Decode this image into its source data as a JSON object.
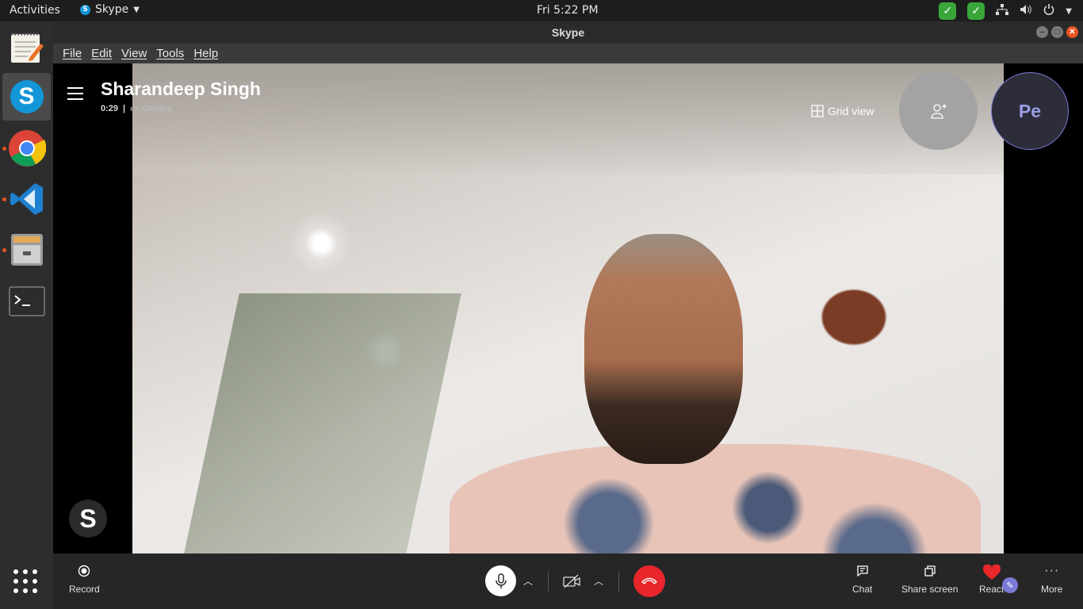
{
  "topbar": {
    "activities": "Activities",
    "app_name": "Skype",
    "clock": "Fri  5:22 PM"
  },
  "window": {
    "title": "Skype"
  },
  "menubar": {
    "items": [
      "File",
      "Edit",
      "View",
      "Tools",
      "Help"
    ]
  },
  "dock": {
    "items": [
      "text-editor",
      "skype",
      "chrome",
      "vscode",
      "files",
      "terminal"
    ],
    "active": "skype"
  },
  "call": {
    "caller_name": "Sharandeep Singh",
    "duration": "0:29",
    "layout_label": "Gallery",
    "grid_view_label": "Grid view",
    "self_initials": "Pe",
    "watermark": "S"
  },
  "controls": {
    "record": "Record",
    "chat": "Chat",
    "share_screen": "Share screen",
    "react": "React",
    "more": "More"
  },
  "colors": {
    "accent_orange": "#e95420",
    "hangup_red": "#e8262b",
    "skype_blue": "#1296d8",
    "avatar_purple": "#7a7ad8",
    "react_heart": "#e8262b"
  }
}
